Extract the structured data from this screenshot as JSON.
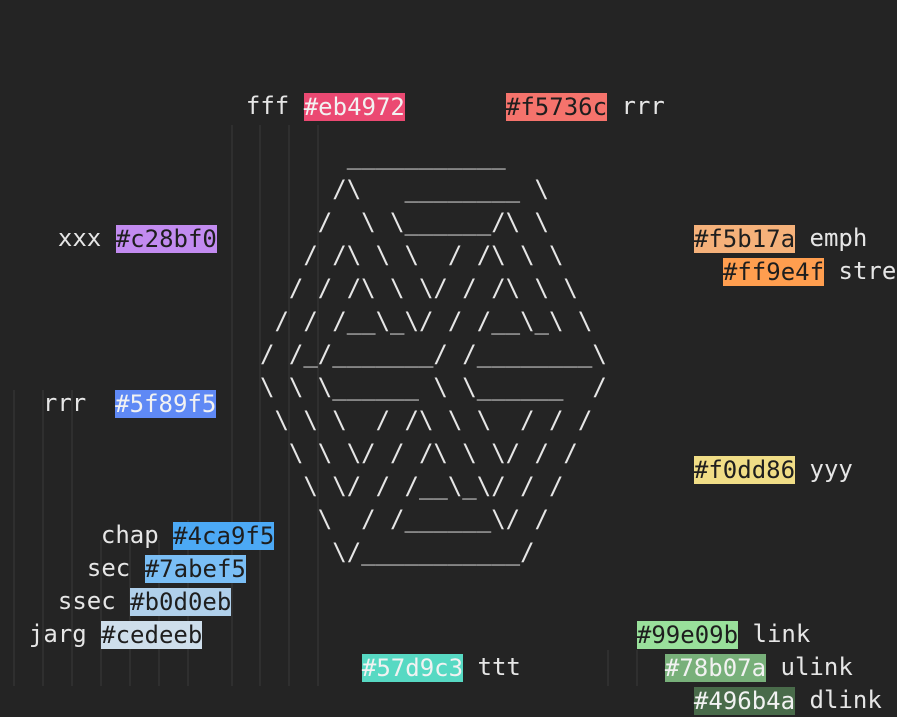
{
  "ascii_art": [
    "      ___________",
    "     /\\   ________ \\",
    "    /  \\ \\______/\\ \\",
    "   / /\\ \\ \\  / /\\ \\ \\",
    "  / / /\\ \\ \\/ / /\\ \\ \\",
    " / / /__\\_\\/ / /__\\_\\ \\",
    "/ /_/_______/ /________\\",
    "\\ \\ \\______ \\ \\______  /",
    " \\ \\ \\  / /\\ \\ \\  / / /",
    "  \\ \\ \\/ / /\\ \\ \\/ / /",
    "   \\ \\/ / /__\\_\\/ / /",
    "    \\  / /______\\/ /",
    "     \\/___________/"
  ],
  "swatches": [
    {
      "id": "fff",
      "label": "fff",
      "hex": "#eb4972",
      "order": "label-first"
    },
    {
      "id": "rrr1",
      "label": "rrr",
      "hex": "#f5736c",
      "order": "chip-first"
    },
    {
      "id": "xxx",
      "label": "xxx",
      "hex": "#c28bf0",
      "order": "label-first"
    },
    {
      "id": "emph",
      "label": "emph",
      "hex": "#f5b17a",
      "order": "chip-first"
    },
    {
      "id": "stress",
      "label": "stress",
      "hex": "#ff9e4f",
      "order": "chip-first"
    },
    {
      "id": "rrr2",
      "label": "rrr",
      "hex": "#5f89f5",
      "order": "label-first"
    },
    {
      "id": "yyy",
      "label": "yyy",
      "hex": "#f0dd86",
      "order": "chip-first"
    },
    {
      "id": "chap",
      "label": "chap",
      "hex": "#4ca9f5",
      "order": "label-first"
    },
    {
      "id": "sec",
      "label": "sec",
      "hex": "#7abef5",
      "order": "label-first"
    },
    {
      "id": "ssec",
      "label": "ssec",
      "hex": "#b0d0eb",
      "order": "label-first"
    },
    {
      "id": "jarg",
      "label": "jarg",
      "hex": "#cedeeb",
      "order": "label-first"
    },
    {
      "id": "link",
      "label": "link",
      "hex": "#99e09b",
      "order": "chip-first"
    },
    {
      "id": "ttt",
      "label": "ttt",
      "hex": "#57d9c3",
      "order": "chip-first"
    },
    {
      "id": "ulink",
      "label": "ulink",
      "hex": "#78b07a",
      "order": "chip-first"
    },
    {
      "id": "dlink",
      "label": "dlink",
      "hex": "#496b4a",
      "order": "chip-first"
    }
  ]
}
